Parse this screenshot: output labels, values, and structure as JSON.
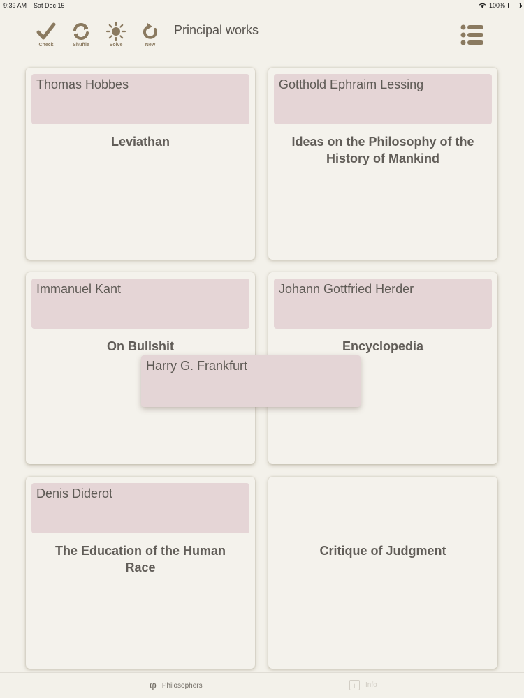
{
  "status_bar": {
    "time": "9:39 AM",
    "date": "Sat Dec 15",
    "battery": "100%"
  },
  "toolbar": {
    "check_label": "Check",
    "shuffle_label": "Shuffle",
    "solve_label": "Solve",
    "new_label": "New",
    "title": "Principal works"
  },
  "cards": [
    {
      "philosopher": "Thomas Hobbes",
      "work": "Leviathan"
    },
    {
      "philosopher": "Gotthold Ephraim Lessing",
      "work": "Ideas on the Philosophy of the History of Mankind"
    },
    {
      "philosopher": "Immanuel Kant",
      "work": "On Bullshit"
    },
    {
      "philosopher": "Johann Gottfried Herder",
      "work": "Encyclopedia"
    },
    {
      "philosopher": "Denis Diderot",
      "work": "The Education of the Human Race"
    },
    {
      "philosopher": "",
      "work": "Critique of Judgment"
    }
  ],
  "dragged_tile": {
    "philosopher": "Harry G. Frankfurt"
  },
  "tab_bar": {
    "philosophers_label": "Philosophers",
    "info_label": "Info",
    "philosophers_icon": "phi-icon",
    "info_icon": "info-icon"
  },
  "colors": {
    "accent": "#8a7a60",
    "tile": "#e5d5d6",
    "background": "#f3f1ea"
  }
}
